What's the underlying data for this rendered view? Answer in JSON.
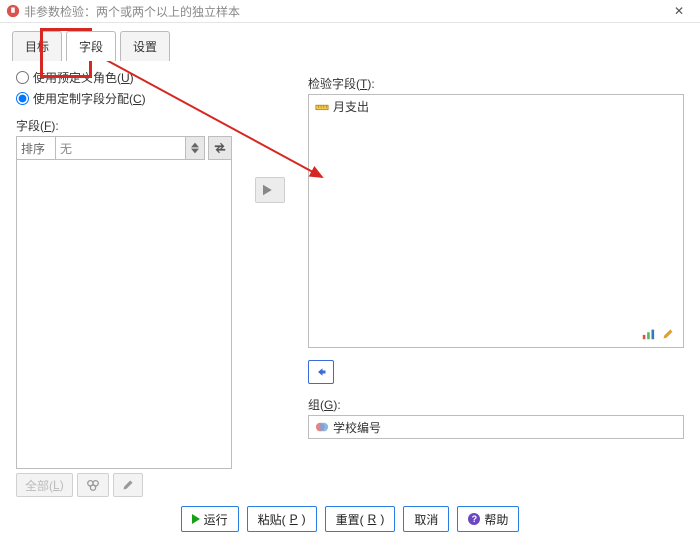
{
  "window": {
    "title": "非参数检验：两个或两个以上的独立样本"
  },
  "tabs": {
    "target": "目标",
    "fields": "字段",
    "settings": "设置"
  },
  "radios": {
    "predefined_prefix": "使用预定义角色(",
    "predefined_key": "U",
    "predefined_suffix": ")",
    "custom_prefix": "使用定制字段分配(",
    "custom_key": "C",
    "custom_suffix": ")"
  },
  "left": {
    "label_prefix": "字段(",
    "label_key": "F",
    "label_suffix": "):",
    "sort_label": "排序",
    "sort_value": "无",
    "all_prefix": "全部(",
    "all_key": "L",
    "all_suffix": ")"
  },
  "right": {
    "test_label_prefix": "检验字段(",
    "test_label_key": "T",
    "test_label_suffix": "):",
    "test_item": "月支出",
    "group_label_prefix": "组(",
    "group_label_key": "G",
    "group_label_suffix": "):",
    "group_item": "学校编号"
  },
  "footer": {
    "run": "运行",
    "paste_prefix": "粘贴(",
    "paste_key": "P",
    "paste_suffix": ")",
    "reset_prefix": "重置(",
    "reset_key": "R",
    "reset_suffix": ")",
    "cancel": "取消",
    "help": "帮助"
  }
}
